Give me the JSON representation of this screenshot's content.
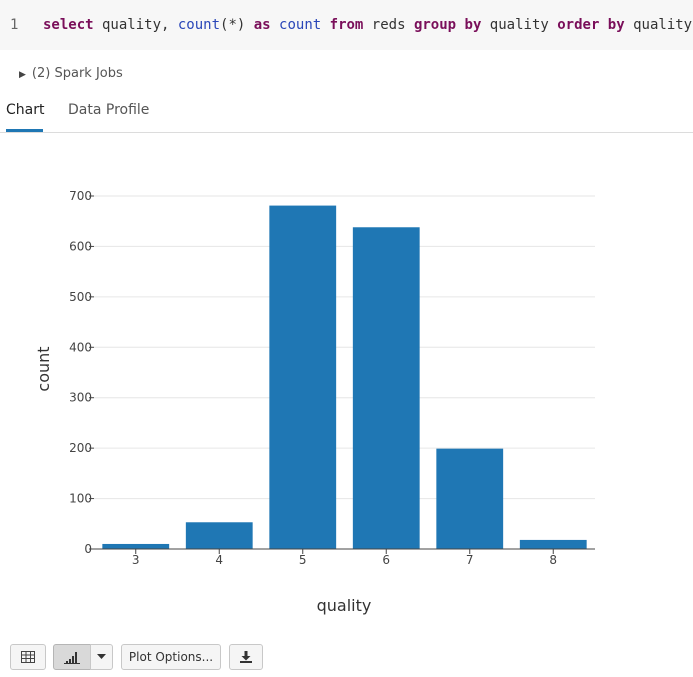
{
  "code": {
    "line_number": "1",
    "tokens": [
      {
        "text": "select",
        "kind": "kw"
      },
      {
        "text": " quality, ",
        "kind": "plain"
      },
      {
        "text": "count",
        "kind": "fn"
      },
      {
        "text": "(*) ",
        "kind": "plain"
      },
      {
        "text": "as",
        "kind": "kw"
      },
      {
        "text": " ",
        "kind": "plain"
      },
      {
        "text": "count",
        "kind": "fn"
      },
      {
        "text": " ",
        "kind": "plain"
      },
      {
        "text": "from",
        "kind": "kw"
      },
      {
        "text": " reds ",
        "kind": "plain"
      },
      {
        "text": "group by",
        "kind": "kw"
      },
      {
        "text": " quality ",
        "kind": "plain"
      },
      {
        "text": "order by",
        "kind": "kw"
      },
      {
        "text": " quality;",
        "kind": "plain"
      }
    ]
  },
  "spark_jobs": {
    "label": "(2) Spark Jobs"
  },
  "tabs": {
    "chart": "Chart",
    "data_profile": "Data Profile"
  },
  "toolbar": {
    "plot_options_label": "Plot Options..."
  },
  "icons": {
    "table_view": "table-icon",
    "bar_chart_view": "bar-chart-icon",
    "dropdown": "chevron-down-icon",
    "download": "download-icon",
    "spark_toggle": "triangle-right-icon"
  },
  "colors": {
    "accent": "#1f77b4",
    "bar": "#1f77b4",
    "keyword": "#7a0f5a",
    "function": "#2a46b8"
  },
  "chart_data": {
    "type": "bar",
    "categories": [
      "3",
      "4",
      "5",
      "6",
      "7",
      "8"
    ],
    "values": [
      10,
      53,
      681,
      638,
      199,
      18
    ],
    "title": "",
    "xlabel": "quality",
    "ylabel": "count",
    "ylim": [
      0,
      700
    ],
    "yticks": [
      0,
      100,
      200,
      300,
      400,
      500,
      600,
      700
    ],
    "grid": true,
    "legend": "none"
  }
}
